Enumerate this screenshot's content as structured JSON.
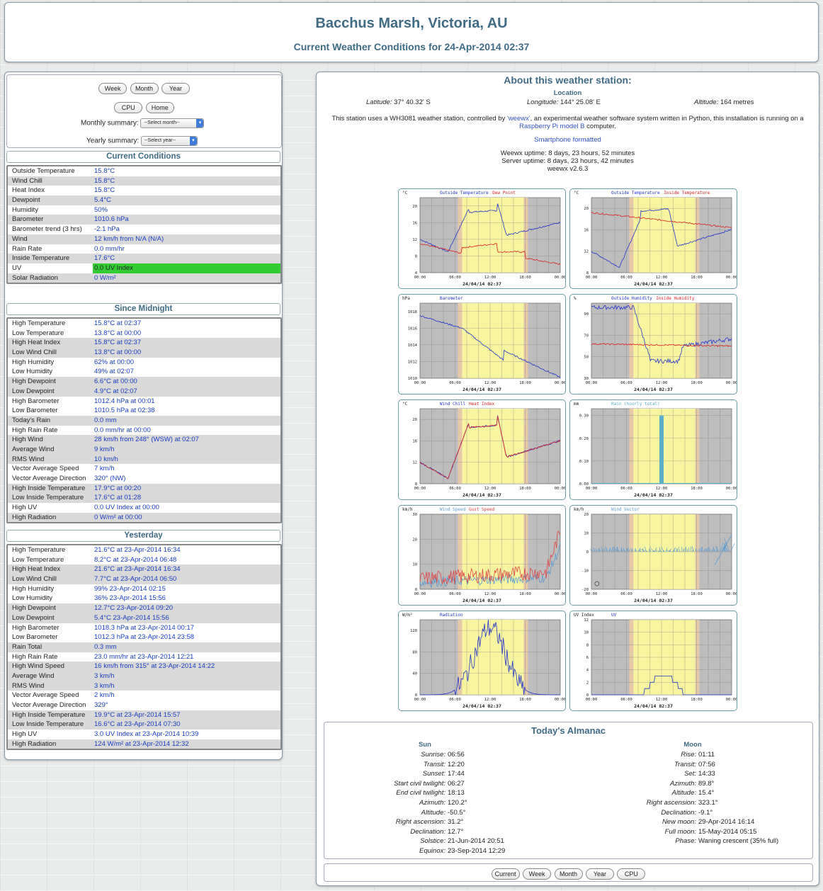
{
  "header": {
    "title": "Bacchus Marsh, Victoria, AU",
    "subtitle": "Current Weather Conditions for 24-Apr-2014 02:37"
  },
  "nav": {
    "week": "Week",
    "month": "Month",
    "year": "Year",
    "cpu": "CPU",
    "home": "Home",
    "monthly_label": "Monthly summary:",
    "monthly_select": "--Select month--",
    "yearly_label": "Yearly summary:",
    "yearly_select": "--Select year--"
  },
  "current": {
    "title": "Current Conditions",
    "rows": [
      {
        "label": "Outside Temperature",
        "value": "15.8°C"
      },
      {
        "label": "Wind Chill",
        "value": "15.8°C"
      },
      {
        "label": "Heat Index",
        "value": "15.8°C"
      },
      {
        "label": "Dewpoint",
        "value": "5.4°C"
      },
      {
        "label": "Humidity",
        "value": "50%"
      },
      {
        "label": "Barometer",
        "value": "1010.6 hPa"
      },
      {
        "label": "Barometer trend (3 hrs)",
        "value": "-2.1 hPa"
      },
      {
        "label": "Wind",
        "value": "12 km/h from N/A (N/A)"
      },
      {
        "label": "Rain Rate",
        "value": "0.0 mm/hr"
      },
      {
        "label": "Inside Temperature",
        "value": "17.6°C"
      },
      {
        "label": "UV",
        "value": "0.0 UV Index"
      },
      {
        "label": "Solar Radiation",
        "value": "0 W/m²"
      }
    ],
    "uv_color": "#33cc33"
  },
  "midnight": {
    "title": "Since Midnight",
    "groups": [
      [
        {
          "label": "High Temperature",
          "value": "15.8°C at 02:37"
        },
        {
          "label": "Low Temperature",
          "value": "13.8°C at 00:00"
        }
      ],
      [
        {
          "label": "High Heat Index",
          "value": "15.8°C at 02:37"
        },
        {
          "label": "Low Wind Chill",
          "value": "13.8°C at 00:00"
        }
      ],
      [
        {
          "label": "High Humidity",
          "value": "62% at 00:00"
        },
        {
          "label": "Low Humidity",
          "value": "49% at 02:07"
        }
      ],
      [
        {
          "label": "High Dewpoint",
          "value": "6.6°C at 00:00"
        },
        {
          "label": "Low Dewpoint",
          "value": "4.9°C at 02:07"
        }
      ],
      [
        {
          "label": "High Barometer",
          "value": "1012.4 hPa at 00:01"
        },
        {
          "label": "Low Barometer",
          "value": "1010.5 hPa at 02:38"
        }
      ],
      [
        {
          "label": "Today's Rain",
          "value": "0.0 mm"
        }
      ],
      [
        {
          "label": "High Rain Rate",
          "value": "0.0 mm/hr at 00:00"
        }
      ],
      [
        {
          "label": "High Wind",
          "value": "28 km/h from 248° (WSW) at 02:07"
        },
        {
          "label": "Average Wind",
          "value": "9 km/h"
        },
        {
          "label": "RMS Wind",
          "value": "10 km/h"
        }
      ],
      [
        {
          "label": "Vector Average Speed",
          "value": "7 km/h"
        },
        {
          "label": "Vector Average Direction",
          "value": "320° (NW)"
        }
      ],
      [
        {
          "label": "High Inside Temperature",
          "value": "17.9°C at 00:20"
        },
        {
          "label": "Low Inside Temperature",
          "value": "17.6°C at 01:28"
        }
      ],
      [
        {
          "label": "High UV",
          "value": "0.0 UV Index at 00:00"
        }
      ],
      [
        {
          "label": "High Radiation",
          "value": "0 W/m² at 00:00"
        }
      ]
    ]
  },
  "yesterday": {
    "title": "Yesterday",
    "groups": [
      [
        {
          "label": "High Temperature",
          "value": "21.6°C at 23-Apr-2014 16:34"
        },
        {
          "label": "Low Temperature",
          "value": "8.2°C at 23-Apr-2014 06:48"
        }
      ],
      [
        {
          "label": "High Heat Index",
          "value": "21.6°C at 23-Apr-2014 16:34"
        },
        {
          "label": "Low Wind Chill",
          "value": "7.7°C at 23-Apr-2014 06:50"
        }
      ],
      [
        {
          "label": "High Humidity",
          "value": "99% 23-Apr-2014 02:15"
        },
        {
          "label": "Low Humidity",
          "value": "36% 23-Apr-2014 15:56"
        }
      ],
      [
        {
          "label": "High Dewpoint",
          "value": "12.7°C 23-Apr-2014 09:20"
        },
        {
          "label": "Low Dewpoint",
          "value": "5.4°C 23-Apr-2014 15:56"
        }
      ],
      [
        {
          "label": "High Barometer",
          "value": "1018.3 hPa at 23-Apr-2014 00:17"
        },
        {
          "label": "Low Barometer",
          "value": "1012.3 hPa at 23-Apr-2014 23:58"
        }
      ],
      [
        {
          "label": "Rain Total",
          "value": "0.3 mm"
        }
      ],
      [
        {
          "label": "High Rain Rate",
          "value": "23.0 mm/hr at 23-Apr-2014 12:21"
        }
      ],
      [
        {
          "label": "High Wind Speed",
          "value": "16 km/h from 315° at 23-Apr-2014 14:22"
        },
        {
          "label": "Average Wind",
          "value": "3 km/h"
        },
        {
          "label": "RMS Wind",
          "value": "3 km/h"
        }
      ],
      [
        {
          "label": "Vector Average Speed",
          "value": "2 km/h"
        },
        {
          "label": "Vector Average Direction",
          "value": "329°"
        }
      ],
      [
        {
          "label": "High Inside Temperature",
          "value": "19.9°C at 23-Apr-2014 15:57"
        },
        {
          "label": "Low Inside Temperature",
          "value": "16.6°C at 23-Apr-2014 07:30"
        }
      ],
      [
        {
          "label": "High UV",
          "value": "3.0 UV Index at 23-Apr-2014 10:39"
        }
      ],
      [
        {
          "label": "High Radiation",
          "value": "124 W/m² at 23-Apr-2014 12:32"
        }
      ]
    ]
  },
  "about": {
    "title": "About this weather station:",
    "location_label": "Location",
    "latitude_label": "Latitude:",
    "latitude": "37° 40.32' S",
    "longitude_label": "Longitude:",
    "longitude": "144° 25.08' E",
    "altitude_label": "Altitude:",
    "altitude": "164 metres",
    "desc_a": "This station uses a WH3081 weather station, controlled by ",
    "desc_link1": "'weewx'",
    "desc_b": ", an experimental weather software system written in Python, this installation is running on a ",
    "desc_link2": "Raspberry Pi model B",
    "desc_c": " computer.",
    "smartphone": "Smartphone formatted",
    "weewx_uptime": "Weewx uptime: 8 days, 23 hours, 52 minutes",
    "server_uptime": "Server uptime: 8 days, 23 hours, 42 minutes",
    "version": "weewx v2.6.3"
  },
  "plots_common": {
    "date": "24/04/14 02:37",
    "xticks": [
      "00:00",
      "06:00",
      "12:00",
      "18:00",
      "00:00"
    ]
  },
  "chart_data": [
    {
      "type": "line",
      "unit": "°C",
      "series": [
        {
          "name": "Outside Temperature",
          "color": "#2233cc"
        },
        {
          "name": "Dew Point",
          "color": "#dd2222"
        }
      ],
      "yticks": [
        "4",
        "8",
        "12",
        "16",
        "20"
      ],
      "ylim": [
        4,
        22
      ]
    },
    {
      "type": "line",
      "unit": "°C",
      "series": [
        {
          "name": "Outside Temperature",
          "color": "#2233cc"
        },
        {
          "name": "Inside Temperature",
          "color": "#dd2222"
        }
      ],
      "yticks": [
        "8",
        "12",
        "16",
        "20"
      ],
      "ylim": [
        8,
        22
      ]
    },
    {
      "type": "line",
      "unit": "hPa",
      "series": [
        {
          "name": "Barometer",
          "color": "#2233cc"
        }
      ],
      "yticks": [
        "1010",
        "1012",
        "1014",
        "1016",
        "1018"
      ],
      "ylim": [
        1010,
        1019
      ]
    },
    {
      "type": "line",
      "unit": "%",
      "series": [
        {
          "name": "Outside Humidity",
          "color": "#2233cc"
        },
        {
          "name": "Inside Humidity",
          "color": "#dd2222"
        }
      ],
      "yticks": [
        "30",
        "50",
        "70",
        "90"
      ],
      "ylim": [
        30,
        100
      ]
    },
    {
      "type": "line",
      "unit": "°C",
      "series": [
        {
          "name": "Wind Chill",
          "color": "#2233cc"
        },
        {
          "name": "Heat Index",
          "color": "#dd2222"
        }
      ],
      "yticks": [
        "8",
        "12",
        "16",
        "20"
      ],
      "ylim": [
        8,
        22
      ]
    },
    {
      "type": "bar",
      "unit": "mm",
      "series": [
        {
          "name": "Rain (hourly total)",
          "color": "#5ab0c8"
        }
      ],
      "yticks": [
        "0.00",
        "0.10",
        "0.20",
        "0.30"
      ],
      "ylim": [
        0,
        0.33
      ]
    },
    {
      "type": "line",
      "unit": "km/h",
      "series": [
        {
          "name": "Wind Speed",
          "color": "#5a9ad0"
        },
        {
          "name": "Gust Speed",
          "color": "#dd4444"
        }
      ],
      "yticks": [
        "0",
        "10",
        "20",
        "30"
      ],
      "ylim": [
        0,
        30
      ]
    },
    {
      "type": "line",
      "unit": "km/h",
      "series": [
        {
          "name": "Wind Vector",
          "color": "#5a9ad0"
        }
      ],
      "yticks": [
        "-20",
        "-10",
        "0",
        "10",
        "20"
      ],
      "ylim": [
        -20,
        20
      ]
    },
    {
      "type": "line",
      "unit": "W/m²",
      "series": [
        {
          "name": "Radiation",
          "color": "#2233cc"
        }
      ],
      "yticks": [
        "0",
        "40",
        "80",
        "120"
      ],
      "ylim": [
        0,
        140
      ]
    },
    {
      "type": "line",
      "unit": "UV Index",
      "series": [
        {
          "name": "UV",
          "color": "#2233cc"
        }
      ],
      "yticks": [
        "0",
        "2",
        "4",
        "6",
        "8",
        "10",
        "12"
      ],
      "ylim": [
        0,
        12
      ]
    }
  ],
  "almanac": {
    "title": "Today's Almanac",
    "sun_title": "Sun",
    "sun": [
      {
        "k": "Sunrise:",
        "v": "06:56"
      },
      {
        "k": "Transit:",
        "v": "12:20"
      },
      {
        "k": "Sunset:",
        "v": "17:44"
      },
      {
        "k": "Start civil twilight:",
        "v": "06:27"
      },
      {
        "k": "End civil twilight:",
        "v": "18:13"
      },
      {
        "k": "Azimuth:",
        "v": "120.2°"
      },
      {
        "k": "Altitude:",
        "v": "-50.5°"
      },
      {
        "k": "Right ascension:",
        "v": "31.2°"
      },
      {
        "k": "Declination:",
        "v": "12.7°"
      },
      {
        "k": "Solstice:",
        "v": "21-Jun-2014 20:51"
      },
      {
        "k": "Equinox:",
        "v": "23-Sep-2014 12:29"
      }
    ],
    "moon_title": "Moon",
    "moon": [
      {
        "k": "Rise:",
        "v": "01:11"
      },
      {
        "k": "Transit:",
        "v": "07:56"
      },
      {
        "k": "Set:",
        "v": "14:33"
      },
      {
        "k": "Azimuth:",
        "v": "89.8°"
      },
      {
        "k": "Altitude:",
        "v": "15.4°"
      },
      {
        "k": "Right ascension:",
        "v": "323.1°"
      },
      {
        "k": "Declination:",
        "v": "-9.1°"
      },
      {
        "k": "New moon:",
        "v": "29-Apr-2014 16:14"
      },
      {
        "k": "Full moon:",
        "v": "15-May-2014 05:15"
      },
      {
        "k": "Phase:",
        "v": "Waning crescent (35% full)"
      }
    ]
  },
  "footer": {
    "current": "Current",
    "week": "Week",
    "month": "Month",
    "year": "Year",
    "cpu": "CPU"
  }
}
